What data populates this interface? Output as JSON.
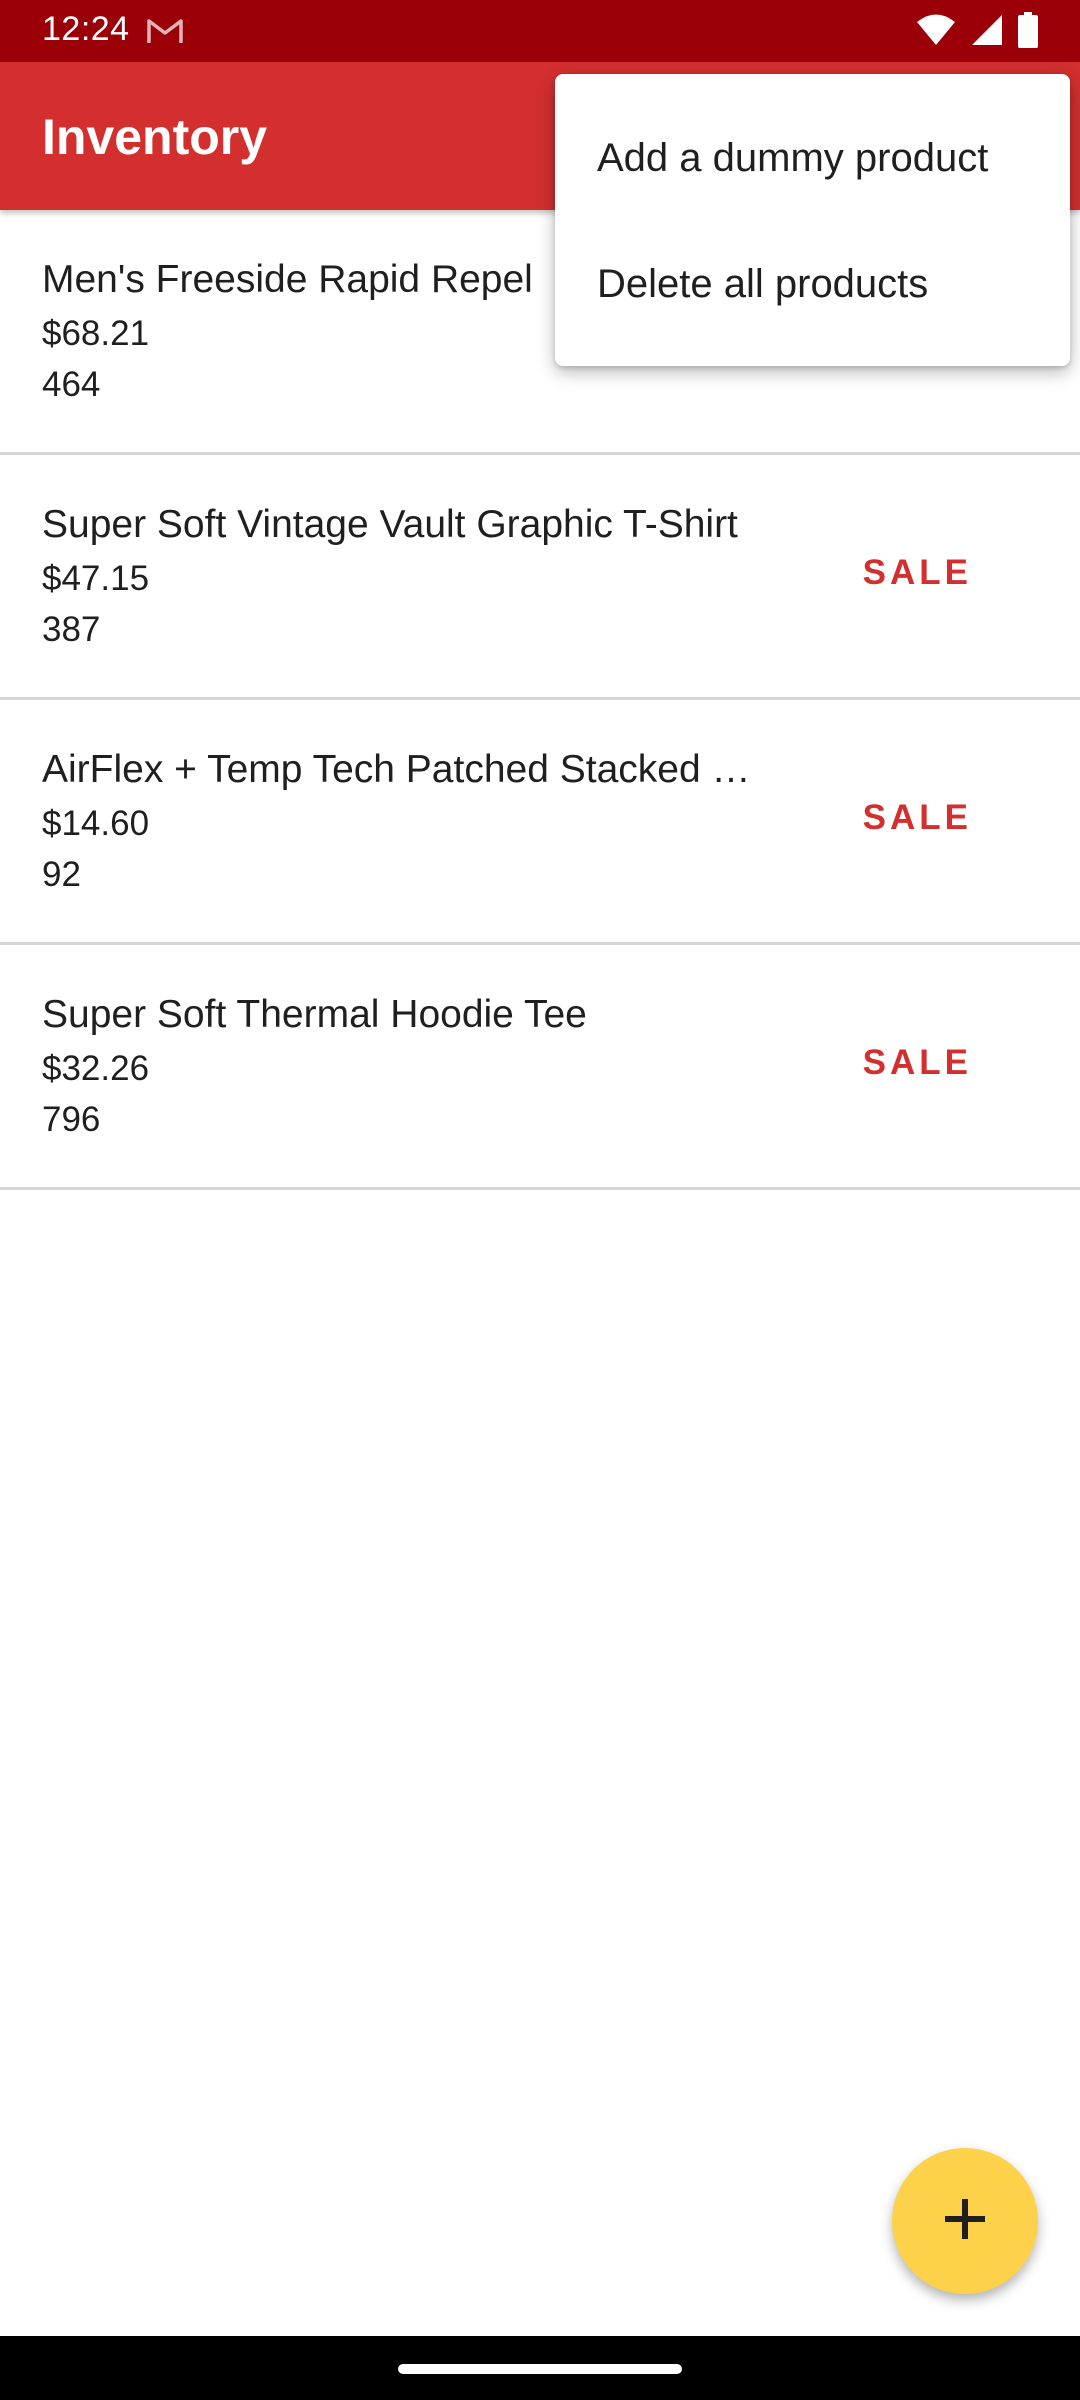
{
  "status_bar": {
    "time": "12:24",
    "icons": [
      "gmail-icon",
      "wifi-icon",
      "cellular-signal-icon",
      "battery-icon"
    ]
  },
  "app_bar": {
    "title": "Inventory"
  },
  "overflow_menu": {
    "items": [
      {
        "label": "Add a dummy product"
      },
      {
        "label": "Delete all products"
      }
    ]
  },
  "products": [
    {
      "name": "Men's Freeside Rapid Repel",
      "price": "$68.21",
      "quantity": "464",
      "sale_label": ""
    },
    {
      "name": "Super Soft Vintage Vault Graphic T-Shirt",
      "price": "$47.15",
      "quantity": "387",
      "sale_label": "SALE"
    },
    {
      "name": "AirFlex + Temp Tech Patched Stacked …",
      "price": "$14.60",
      "quantity": "92",
      "sale_label": "SALE"
    },
    {
      "name": "Super Soft Thermal Hoodie Tee",
      "price": "$32.26",
      "quantity": "796",
      "sale_label": "SALE"
    }
  ],
  "fab": {
    "icon": "plus-icon"
  },
  "colors": {
    "status_bar": "#9b0008",
    "app_bar": "#d32f2f",
    "sale": "#d32f2f",
    "fab": "#fdd24a"
  }
}
